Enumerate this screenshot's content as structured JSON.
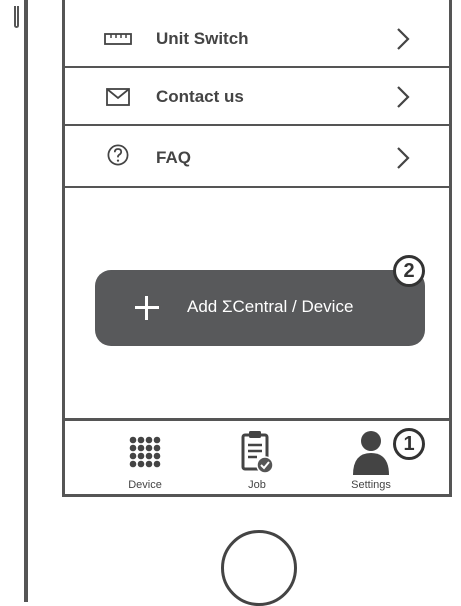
{
  "menu": {
    "items": [
      {
        "label": "Unit Switch",
        "icon": "ruler-icon"
      },
      {
        "label": "Contact us",
        "icon": "envelope-icon"
      },
      {
        "label": "FAQ",
        "icon": "question-circle-icon"
      }
    ]
  },
  "add_button": {
    "label": "Add ΣCentral / Device",
    "callout": "2"
  },
  "tabbar": {
    "tabs": [
      {
        "label": "Device",
        "icon": "grid-dots-icon"
      },
      {
        "label": "Job",
        "icon": "clipboard-check-icon"
      },
      {
        "label": "Settings",
        "icon": "person-icon",
        "callout": "1"
      }
    ]
  },
  "colors": {
    "button_bg": "#58595b",
    "outline": "#555555"
  }
}
